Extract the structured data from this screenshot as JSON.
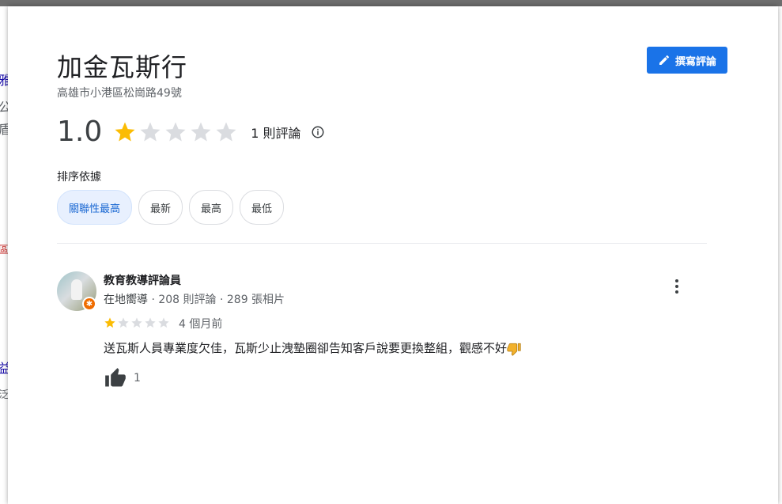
{
  "place": {
    "name": "加金瓦斯行",
    "address": "高雄市小港區松崗路49號"
  },
  "write_review": {
    "label": "撰寫評論",
    "icon": "pencil-icon"
  },
  "summary": {
    "rating": "1.0",
    "stars": 1,
    "max_stars": 5,
    "review_count": "1 則評論",
    "info_icon": "info-icon"
  },
  "sort": {
    "label": "排序依據",
    "options": [
      "關聯性最高",
      "最新",
      "最高",
      "最低"
    ],
    "selected": "關聯性最高"
  },
  "reviews": [
    {
      "author": "教育教導評論員",
      "badge": "在地嚮導",
      "review_stats": "208 則評論",
      "photo_stats": "289 張相片",
      "stars": 1,
      "time": "4 個月前",
      "text": "送瓦斯人員專業度欠佳，瓦斯少止洩墊圈卻告知客戶說要更換整組，觀感不好",
      "likes": "1"
    }
  ],
  "background_fragments": [
    "雅",
    "公",
    "盾",
    "區",
    "益",
    "泛"
  ],
  "colors": {
    "accent": "#1a73e8",
    "star_filled": "#fbbc04",
    "star_empty": "#dadce0",
    "chip_active_bg": "#e8f0fe",
    "guide_badge": "#ef6c00"
  }
}
